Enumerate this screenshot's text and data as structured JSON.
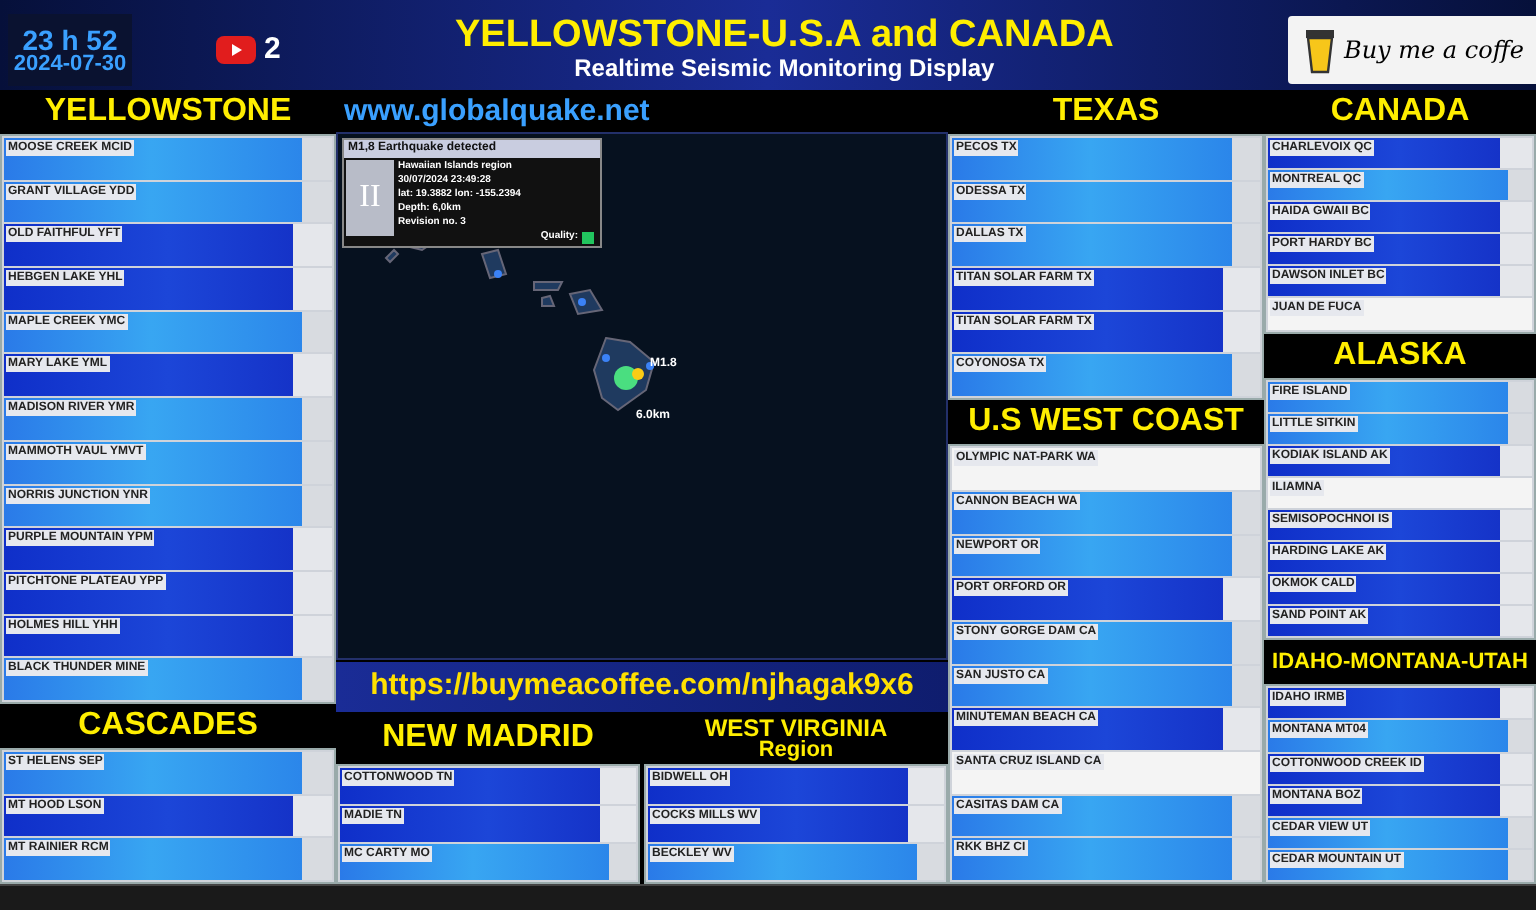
{
  "clock": {
    "time": "23 h 52",
    "date": "2024-07-30"
  },
  "youtube": {
    "count": "2"
  },
  "header": {
    "title": "YELLOWSTONE-U.S.A and CANADA",
    "subtitle": "Realtime Seismic Monitoring Display"
  },
  "coffee_button": {
    "label": "Buy me a coffe"
  },
  "left_column": [
    {
      "title": "YELLOWSTONE",
      "stations": [
        {
          "name": "MOOSE CREEK MCID",
          "kind": "bright"
        },
        {
          "name": "GRANT VILLAGE YDD",
          "kind": "bright"
        },
        {
          "name": "OLD FAITHFUL YFT",
          "kind": "dark"
        },
        {
          "name": "HEBGEN LAKE YHL",
          "kind": "dark"
        },
        {
          "name": "MAPLE CREEK YMC",
          "kind": "bright"
        },
        {
          "name": "MARY LAKE YML",
          "kind": "dark"
        },
        {
          "name": "MADISON RIVER YMR",
          "kind": "bright"
        },
        {
          "name": "MAMMOTH VAUL YMVT",
          "kind": "bright"
        },
        {
          "name": "NORRIS JUNCTION YNR",
          "kind": "bright"
        },
        {
          "name": "PURPLE MOUNTAIN YPM",
          "kind": "dark"
        },
        {
          "name": "PITCHTONE PLATEAU YPP",
          "kind": "dark"
        },
        {
          "name": "HOLMES HILL YHH",
          "kind": "dark"
        },
        {
          "name": "BLACK THUNDER MINE",
          "kind": "bright"
        }
      ]
    },
    {
      "title": "CASCADES",
      "stations": [
        {
          "name": "ST HELENS SEP",
          "kind": "bright"
        },
        {
          "name": "MT HOOD LSON",
          "kind": "dark"
        },
        {
          "name": "MT RAINIER RCM",
          "kind": "bright"
        }
      ]
    }
  ],
  "center": {
    "site": "www.globalquake.net",
    "event": {
      "title": "M1,8 Earthquake detected",
      "intensity": "II",
      "lines": [
        "Hawaiian Islands region",
        "30/07/2024 23:49:28",
        "lat: 19.3882 lon: -155.2394",
        "Depth: 6,0km",
        "Revision no. 3"
      ],
      "quality_label": "Quality:"
    },
    "marker": {
      "magnitude": "M1.8",
      "depth": "6.0km"
    },
    "banner": "https://buymeacoffee.com/njhagak9x6",
    "bottom_regions": [
      {
        "title": "NEW MADRID",
        "stations": [
          {
            "name": "COTTONWOOD TN",
            "kind": "dark"
          },
          {
            "name": "MADIE TN",
            "kind": "dark"
          },
          {
            "name": "MC CARTY MO",
            "kind": "bright"
          }
        ]
      },
      {
        "title": "WEST VIRGINIA",
        "subtitle": "Region",
        "stations": [
          {
            "name": "BIDWELL OH",
            "kind": "dark"
          },
          {
            "name": "COCKS MILLS WV",
            "kind": "dark"
          },
          {
            "name": "BECKLEY WV",
            "kind": "bright"
          }
        ]
      }
    ]
  },
  "texas_column": [
    {
      "title": "TEXAS",
      "stations": [
        {
          "name": "PECOS TX",
          "kind": "bright"
        },
        {
          "name": "ODESSA TX",
          "kind": "bright"
        },
        {
          "name": "DALLAS TX",
          "kind": "bright"
        },
        {
          "name": "TITAN SOLAR FARM TX",
          "kind": "dark"
        },
        {
          "name": "TITAN SOLAR FARM TX",
          "kind": "dark"
        },
        {
          "name": "COYONOSA TX",
          "kind": "bright"
        }
      ]
    },
    {
      "title": "U.S WEST COAST",
      "stations": [
        {
          "name": "OLYMPIC NAT-PARK WA",
          "kind": "blank"
        },
        {
          "name": "CANNON BEACH WA",
          "kind": "bright"
        },
        {
          "name": "NEWPORT OR",
          "kind": "bright"
        },
        {
          "name": "PORT ORFORD OR",
          "kind": "dark"
        },
        {
          "name": "STONY GORGE DAM CA",
          "kind": "bright"
        },
        {
          "name": "SAN JUSTO CA",
          "kind": "bright"
        },
        {
          "name": "MINUTEMAN BEACH CA",
          "kind": "dark"
        },
        {
          "name": "SANTA CRUZ ISLAND CA",
          "kind": "blank"
        },
        {
          "name": "CASITAS DAM CA",
          "kind": "bright"
        },
        {
          "name": "RKK BHZ CI",
          "kind": "bright"
        }
      ]
    }
  ],
  "right_column": [
    {
      "title": "CANADA",
      "stations": [
        {
          "name": "CHARLEVOIX QC",
          "kind": "dark"
        },
        {
          "name": "MONTREAL QC",
          "kind": "bright"
        },
        {
          "name": "HAIDA GWAII BC",
          "kind": "dark"
        },
        {
          "name": "PORT HARDY BC",
          "kind": "dark"
        },
        {
          "name": "DAWSON INLET BC",
          "kind": "dark"
        },
        {
          "name": "JUAN DE FUCA",
          "kind": "blank"
        }
      ]
    },
    {
      "title": "ALASKA",
      "stations": [
        {
          "name": "FIRE ISLAND",
          "kind": "bright"
        },
        {
          "name": "LITTLE SITKIN",
          "kind": "bright"
        },
        {
          "name": "KODIAK ISLAND AK",
          "kind": "dark"
        },
        {
          "name": "ILIAMNA",
          "kind": "blank"
        },
        {
          "name": "SEMISOPOCHNOI IS",
          "kind": "dark"
        },
        {
          "name": "HARDING LAKE AK",
          "kind": "dark"
        },
        {
          "name": "OKMOK CALD",
          "kind": "dark"
        },
        {
          "name": "SAND POINT AK",
          "kind": "dark"
        }
      ]
    },
    {
      "title": "IDAHO-MONTANA-UTAH",
      "stations": [
        {
          "name": "IDAHO IRMB",
          "kind": "dark"
        },
        {
          "name": "MONTANA MT04",
          "kind": "bright"
        },
        {
          "name": "COTTONWOOD CREEK ID",
          "kind": "dark"
        },
        {
          "name": "MONTANA BOZ",
          "kind": "dark"
        },
        {
          "name": "CEDAR VIEW UT",
          "kind": "bright"
        },
        {
          "name": "CEDAR MOUNTAIN UT",
          "kind": "bright"
        }
      ]
    }
  ]
}
